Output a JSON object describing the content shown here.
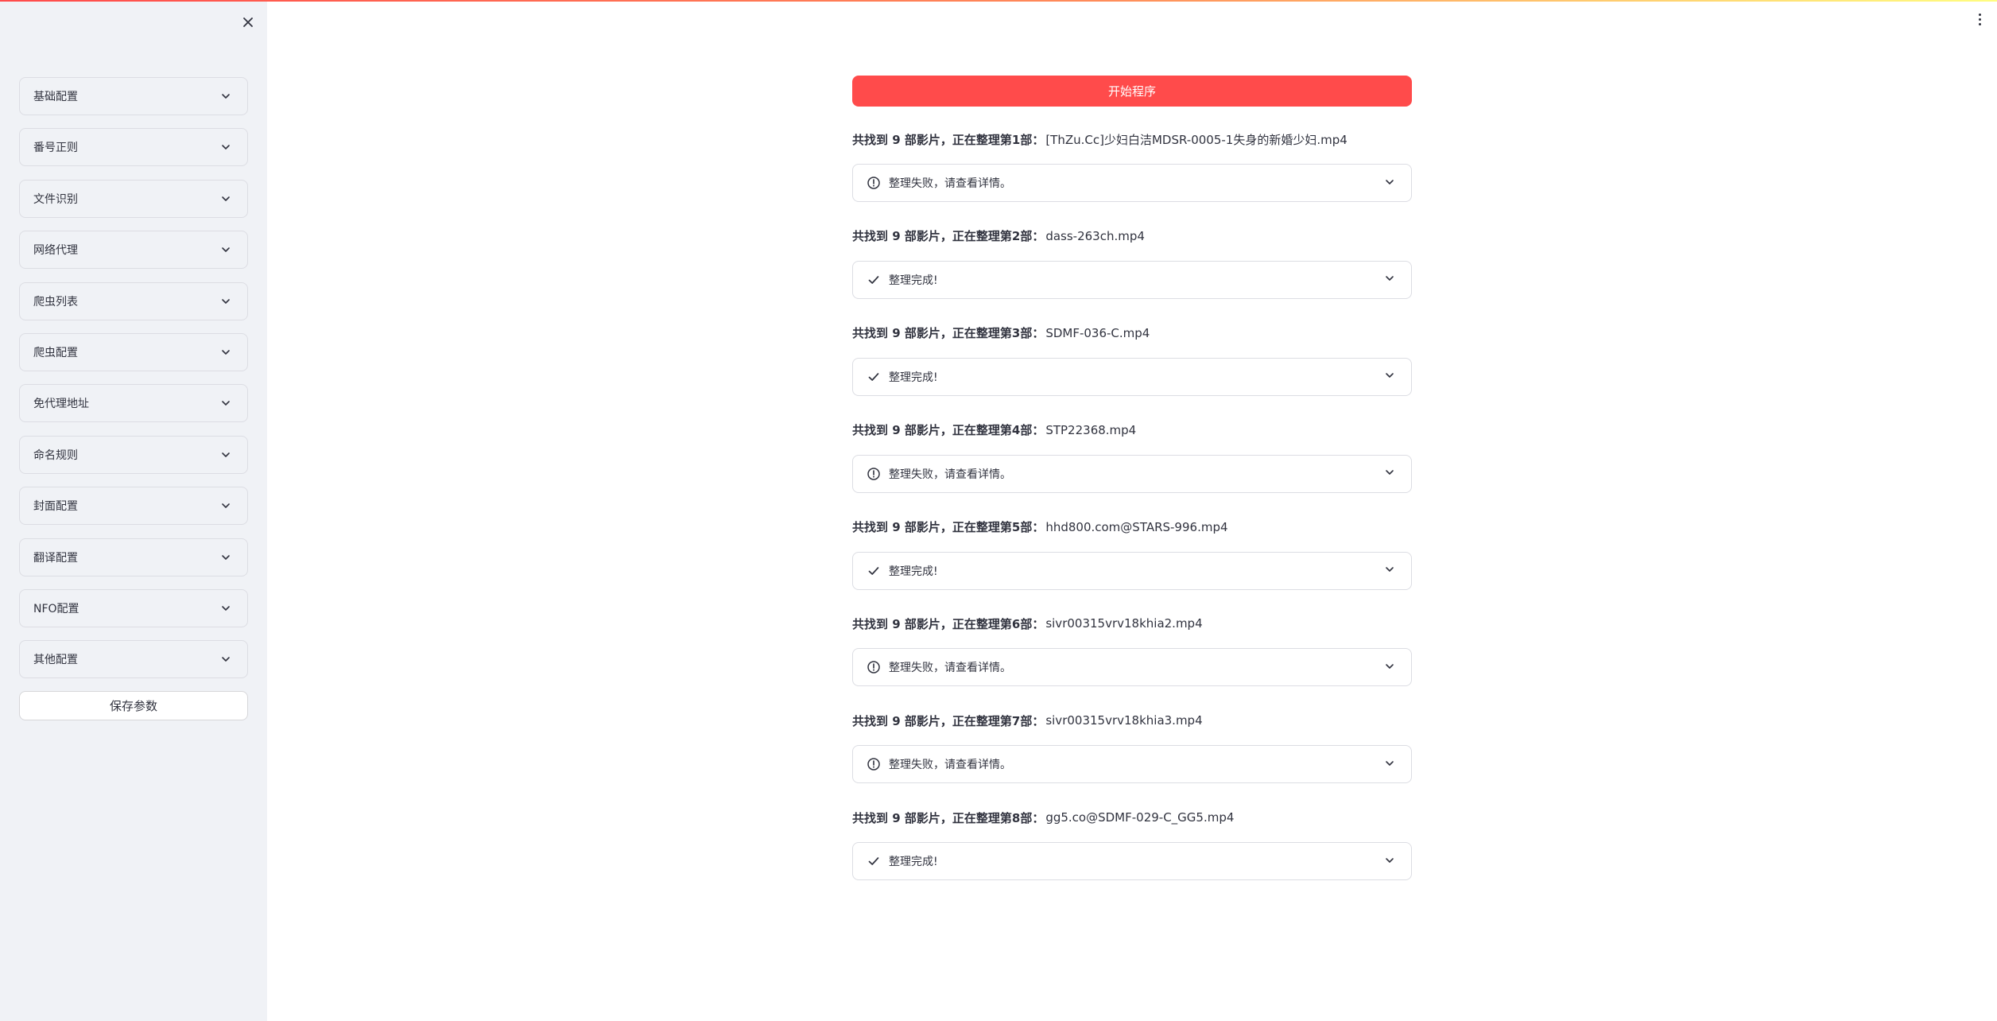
{
  "sidebar": {
    "items": [
      {
        "label": "基础配置"
      },
      {
        "label": "番号正则"
      },
      {
        "label": "文件识别"
      },
      {
        "label": "网络代理"
      },
      {
        "label": "爬虫列表"
      },
      {
        "label": "爬虫配置"
      },
      {
        "label": "免代理地址"
      },
      {
        "label": "命名规则"
      },
      {
        "label": "封面配置"
      },
      {
        "label": "翻译配置"
      },
      {
        "label": "NFO配置"
      },
      {
        "label": "其他配置"
      }
    ],
    "save_label": "保存参数"
  },
  "main": {
    "start_label": "开始程序",
    "entries": [
      {
        "prefix": "共找到 9 部影片，正在整理第1部：",
        "filename": "[ThZu.Cc]少妇白洁MDSR-0005-1失身的新婚少妇.mp4",
        "status": "error",
        "message": "整理失败，请查看详情。"
      },
      {
        "prefix": "共找到 9 部影片，正在整理第2部：",
        "filename": "dass-263ch.mp4",
        "status": "success",
        "message": "整理完成!"
      },
      {
        "prefix": "共找到 9 部影片，正在整理第3部：",
        "filename": "SDMF-036-C.mp4",
        "status": "success",
        "message": "整理完成!"
      },
      {
        "prefix": "共找到 9 部影片，正在整理第4部：",
        "filename": "STP22368.mp4",
        "status": "error",
        "message": "整理失败，请查看详情。"
      },
      {
        "prefix": "共找到 9 部影片，正在整理第5部：",
        "filename": "hhd800.com@STARS-996.mp4",
        "status": "success",
        "message": "整理完成!"
      },
      {
        "prefix": "共找到 9 部影片，正在整理第6部：",
        "filename": "sivr00315vrv18khia2.mp4",
        "status": "error",
        "message": "整理失败，请查看详情。"
      },
      {
        "prefix": "共找到 9 部影片，正在整理第7部：",
        "filename": "sivr00315vrv18khia3.mp4",
        "status": "error",
        "message": "整理失败，请查看详情。"
      },
      {
        "prefix": "共找到 9 部影片，正在整理第8部：",
        "filename": "gg5.co@SDMF-029-C_GG5.mp4",
        "status": "success",
        "message": "整理完成!"
      }
    ]
  },
  "icons": {
    "close": "close-icon",
    "menu": "kebab-menu-icon",
    "chevron": "chevron-down-icon",
    "error": "error-circle-icon",
    "success": "check-icon"
  },
  "colors": {
    "accent": "#ff4b4b",
    "sidebar_bg": "#f0f2f6",
    "text": "#31333f"
  }
}
